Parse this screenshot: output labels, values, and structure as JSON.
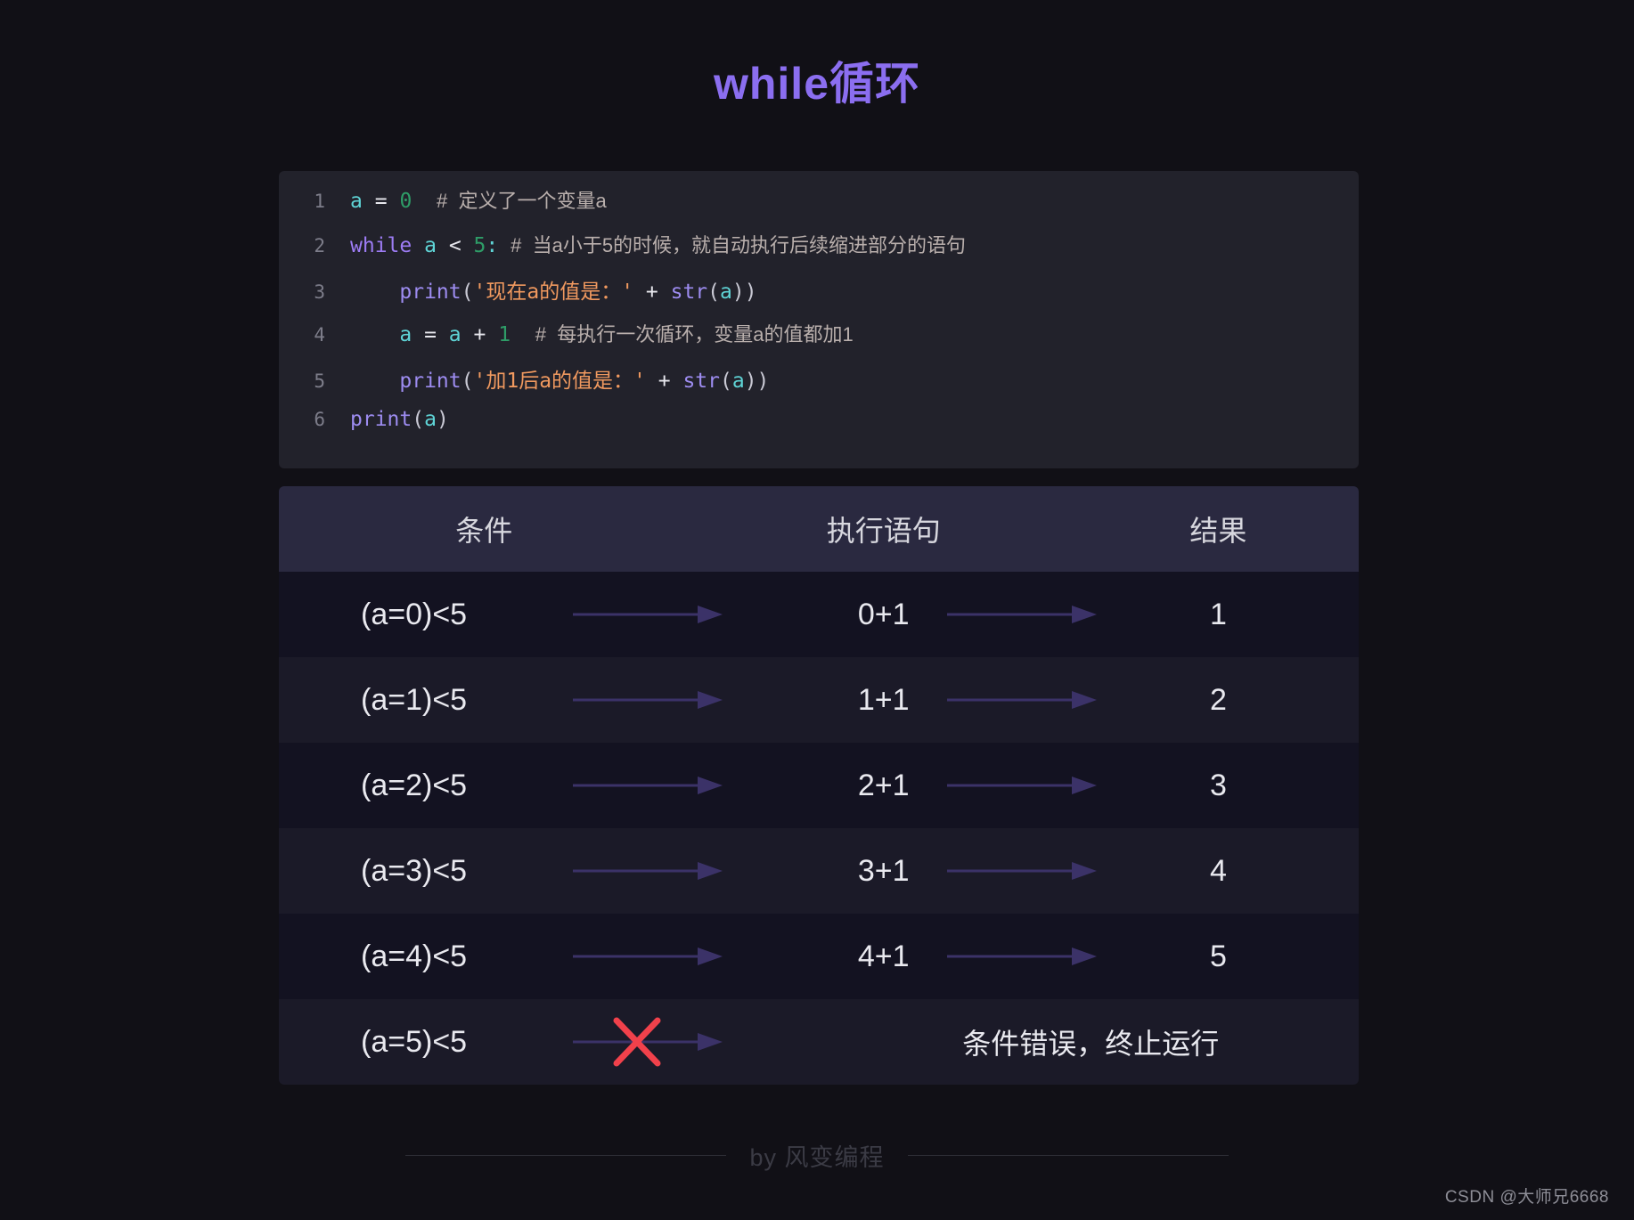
{
  "title": "while循环",
  "theme": {
    "page_bg": "#111016",
    "title_color": "#8b6ef0",
    "code_bg": "#22222b",
    "table_header_bg": "#2a2940",
    "row_odd_bg": "#131221",
    "row_even_bg": "#1b1a28",
    "arrow_color": "#3b3268",
    "x_color": "#f1414b"
  },
  "code": {
    "lines": [
      {
        "number": "1",
        "tokens": [
          {
            "t": "a",
            "c": "tok-var"
          },
          {
            "t": " ",
            "c": "tok-op"
          },
          {
            "t": "=",
            "c": "tok-op"
          },
          {
            "t": " ",
            "c": "tok-op"
          },
          {
            "t": "0",
            "c": "tok-num"
          },
          {
            "t": "  ",
            "c": "tok-op"
          },
          {
            "t": "#  定义了一个变量a",
            "c": "tok-com"
          }
        ]
      },
      {
        "number": "2",
        "tokens": [
          {
            "t": "while",
            "c": "tok-kw"
          },
          {
            "t": " ",
            "c": "tok-op"
          },
          {
            "t": "a",
            "c": "tok-var"
          },
          {
            "t": " ",
            "c": "tok-op"
          },
          {
            "t": "<",
            "c": "tok-op"
          },
          {
            "t": " ",
            "c": "tok-op"
          },
          {
            "t": "5",
            "c": "tok-num"
          },
          {
            "t": ":",
            "c": "tok-colon"
          },
          {
            "t": " ",
            "c": "tok-op"
          },
          {
            "t": "#  当a小于5的时候，就自动执行后续缩进部分的语句",
            "c": "tok-com"
          }
        ]
      },
      {
        "number": "3",
        "tokens": [
          {
            "t": "    ",
            "c": "tok-op"
          },
          {
            "t": "print",
            "c": "tok-fn"
          },
          {
            "t": "(",
            "c": "tok-punct"
          },
          {
            "t": "'现在a的值是：'",
            "c": "tok-str"
          },
          {
            "t": " + ",
            "c": "tok-op"
          },
          {
            "t": "str",
            "c": "tok-fn"
          },
          {
            "t": "(",
            "c": "tok-punct"
          },
          {
            "t": "a",
            "c": "tok-var"
          },
          {
            "t": "))",
            "c": "tok-punct"
          }
        ]
      },
      {
        "number": "4",
        "tokens": [
          {
            "t": "    ",
            "c": "tok-op"
          },
          {
            "t": "a",
            "c": "tok-var"
          },
          {
            "t": " = ",
            "c": "tok-op"
          },
          {
            "t": "a",
            "c": "tok-var"
          },
          {
            "t": " + ",
            "c": "tok-op"
          },
          {
            "t": "1",
            "c": "tok-num"
          },
          {
            "t": "  ",
            "c": "tok-op"
          },
          {
            "t": "#  每执行一次循环，变量a的值都加1",
            "c": "tok-com"
          }
        ]
      },
      {
        "number": "5",
        "tokens": [
          {
            "t": "    ",
            "c": "tok-op"
          },
          {
            "t": "print",
            "c": "tok-fn"
          },
          {
            "t": "(",
            "c": "tok-punct"
          },
          {
            "t": "'加1后a的值是：'",
            "c": "tok-str"
          },
          {
            "t": " + ",
            "c": "tok-op"
          },
          {
            "t": "str",
            "c": "tok-fn"
          },
          {
            "t": "(",
            "c": "tok-punct"
          },
          {
            "t": "a",
            "c": "tok-var"
          },
          {
            "t": "))",
            "c": "tok-punct"
          }
        ]
      },
      {
        "number": "6",
        "tokens": [
          {
            "t": "print",
            "c": "tok-fn"
          },
          {
            "t": "(",
            "c": "tok-punct"
          },
          {
            "t": "a",
            "c": "tok-var"
          },
          {
            "t": ")",
            "c": "tok-punct"
          }
        ]
      }
    ]
  },
  "table": {
    "headers": [
      "条件",
      "执行语句",
      "结果"
    ],
    "rows": [
      {
        "condition": "(a=0)<5",
        "statement": "0+1",
        "result": "1",
        "terminal": false
      },
      {
        "condition": "(a=1)<5",
        "statement": "1+1",
        "result": "2",
        "terminal": false
      },
      {
        "condition": "(a=2)<5",
        "statement": "2+1",
        "result": "3",
        "terminal": false
      },
      {
        "condition": "(a=3)<5",
        "statement": "3+1",
        "result": "4",
        "terminal": false
      },
      {
        "condition": "(a=4)<5",
        "statement": "4+1",
        "result": "5",
        "terminal": false
      },
      {
        "condition": "(a=5)<5",
        "statement": "条件错误，终止运行",
        "result": "",
        "terminal": true
      }
    ]
  },
  "footer": {
    "by_text": "by 风变编程"
  },
  "watermark": "CSDN @大师兄6668"
}
